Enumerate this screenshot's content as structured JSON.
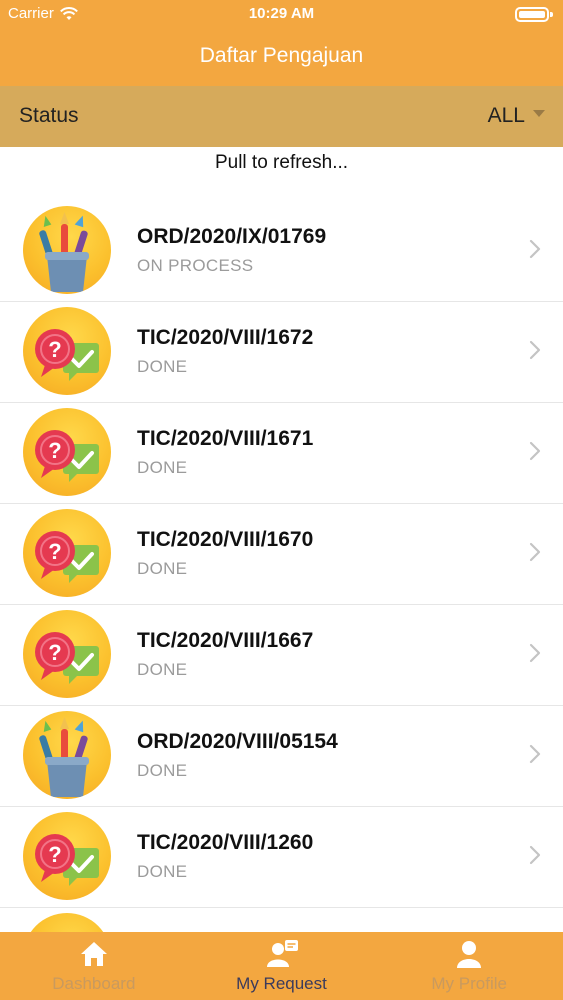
{
  "status_bar": {
    "carrier": "Carrier",
    "time": "10:29 AM"
  },
  "header": {
    "title": "Daftar Pengajuan"
  },
  "filter": {
    "label": "Status",
    "value": "ALL"
  },
  "refresh_text": "Pull to refresh...",
  "requests": [
    {
      "id": "ORD/2020/IX/01769",
      "status": "ON PROCESS",
      "icon": "paint-brushes-icon"
    },
    {
      "id": "TIC/2020/VIII/1672",
      "status": "DONE",
      "icon": "question-check-icon"
    },
    {
      "id": "TIC/2020/VIII/1671",
      "status": "DONE",
      "icon": "question-check-icon"
    },
    {
      "id": "TIC/2020/VIII/1670",
      "status": "DONE",
      "icon": "question-check-icon"
    },
    {
      "id": "TIC/2020/VIII/1667",
      "status": "DONE",
      "icon": "question-check-icon"
    },
    {
      "id": "ORD/2020/VIII/05154",
      "status": "DONE",
      "icon": "paint-brushes-icon"
    },
    {
      "id": "TIC/2020/VIII/1260",
      "status": "DONE",
      "icon": "question-check-icon"
    }
  ],
  "tabs": [
    {
      "label": "Dashboard",
      "icon": "home-icon",
      "active": false
    },
    {
      "label": "My Request",
      "icon": "request-icon",
      "active": true
    },
    {
      "label": "My Profile",
      "icon": "profile-icon",
      "active": false
    }
  ],
  "colors": {
    "header": "#f3a740",
    "filter_bar": "#d6aa5b",
    "status_text": "#9b9b9b",
    "active_tab": "#3b3b5c",
    "inactive_tab": "#c99a5e"
  }
}
